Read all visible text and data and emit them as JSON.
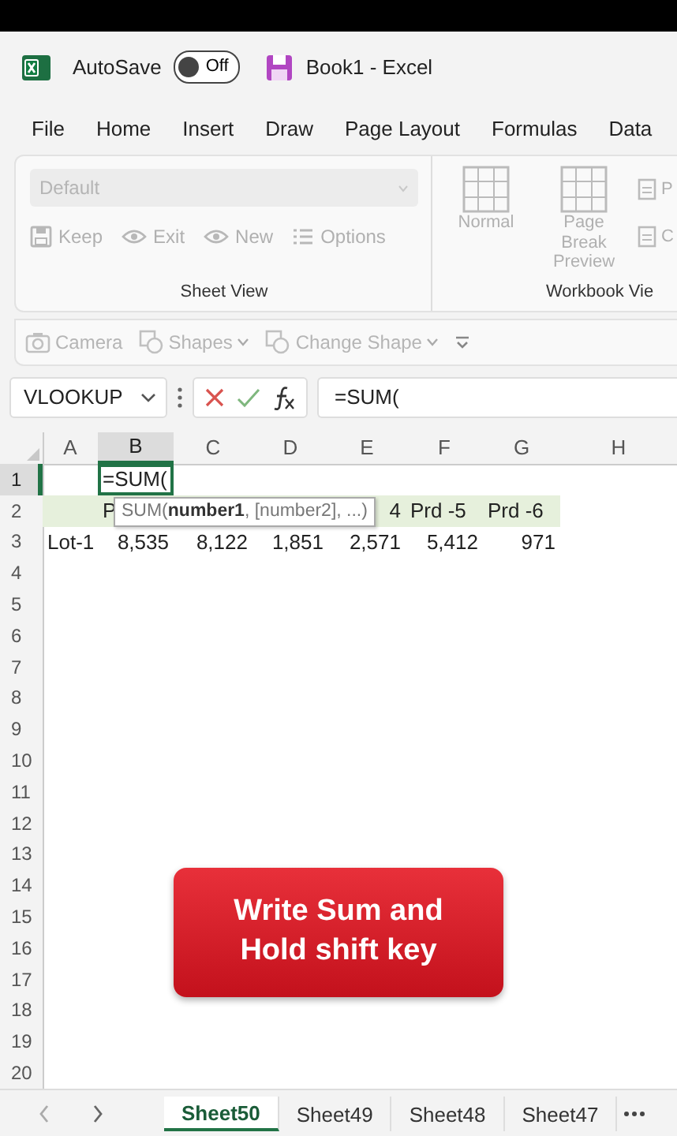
{
  "title_bar": {
    "autosave_label": "AutoSave",
    "autosave": {
      "on": false,
      "label": "Off"
    },
    "title": "Book1 - Excel"
  },
  "menu_tabs": [
    "File",
    "Home",
    "Insert",
    "Draw",
    "Page Layout",
    "Formulas",
    "Data"
  ],
  "ribbon": {
    "style_dropdown": {
      "value": "Default",
      "disabled": true
    },
    "sheet_view_buttons": [
      {
        "label": "Keep",
        "kind": "save"
      },
      {
        "label": "Exit",
        "kind": "eye"
      },
      {
        "label": "New",
        "kind": "eye"
      },
      {
        "label": "Options",
        "kind": "list"
      }
    ],
    "sheet_view_label": "Sheet View",
    "workbook_buttons": [
      {
        "label": "Normal",
        "kind": "large"
      },
      {
        "label": "Page Break Preview",
        "kind": "large"
      },
      {
        "label": "P",
        "kind": "small"
      },
      {
        "label": "C",
        "kind": "small"
      }
    ],
    "workbook_label": "Workbook Vie"
  },
  "quick_bar": [
    {
      "label": "Camera",
      "kind": "camera",
      "dropdown": false
    },
    {
      "label": "Shapes",
      "kind": "shapes",
      "dropdown": true
    },
    {
      "label": "Change Shape",
      "kind": "shapes",
      "dropdown": true
    }
  ],
  "formula_bar": {
    "name_box": "VLOOKUP",
    "formula": "=SUM("
  },
  "sheet": {
    "columns": [
      {
        "label": "A",
        "selected": false
      },
      {
        "label": "B",
        "selected": true
      },
      {
        "label": "C",
        "selected": false
      },
      {
        "label": "D",
        "selected": false
      },
      {
        "label": "E",
        "selected": false
      },
      {
        "label": "F",
        "selected": false
      },
      {
        "label": "G",
        "selected": false
      },
      {
        "label": "H",
        "selected": false
      }
    ],
    "rows": [
      {
        "number": "1",
        "selected": true,
        "highlighted": false,
        "kind": "edit",
        "cells": [
          "",
          "=SUM("
        ]
      },
      {
        "number": "2",
        "selected": false,
        "highlighted": true,
        "kind": "header",
        "cells": [
          "",
          "P",
          "",
          "",
          "4",
          "Prd -5",
          "Prd -6"
        ]
      },
      {
        "number": "3",
        "selected": false,
        "highlighted": false,
        "kind": "data",
        "cells": [
          "Lot-1",
          "8,535",
          "8,122",
          "1,851",
          "2,571",
          "5,412",
          "971"
        ]
      },
      {
        "number": "4",
        "selected": false,
        "highlighted": false,
        "kind": "empty",
        "cells": []
      },
      {
        "number": "5",
        "selected": false,
        "highlighted": false,
        "kind": "empty",
        "cells": []
      },
      {
        "number": "6",
        "selected": false,
        "highlighted": false,
        "kind": "empty",
        "cells": []
      },
      {
        "number": "7",
        "selected": false,
        "highlighted": false,
        "kind": "empty",
        "cells": []
      },
      {
        "number": "8",
        "selected": false,
        "highlighted": false,
        "kind": "empty",
        "cells": []
      },
      {
        "number": "9",
        "selected": false,
        "highlighted": false,
        "kind": "empty",
        "cells": []
      },
      {
        "number": "10",
        "selected": false,
        "highlighted": false,
        "kind": "empty",
        "cells": []
      },
      {
        "number": "11",
        "selected": false,
        "highlighted": false,
        "kind": "empty",
        "cells": []
      },
      {
        "number": "12",
        "selected": false,
        "highlighted": false,
        "kind": "empty",
        "cells": []
      },
      {
        "number": "13",
        "selected": false,
        "highlighted": false,
        "kind": "empty",
        "cells": []
      },
      {
        "number": "14",
        "selected": false,
        "highlighted": false,
        "kind": "empty",
        "cells": []
      },
      {
        "number": "15",
        "selected": false,
        "highlighted": false,
        "kind": "empty",
        "cells": []
      },
      {
        "number": "16",
        "selected": false,
        "highlighted": false,
        "kind": "empty",
        "cells": []
      },
      {
        "number": "17",
        "selected": false,
        "highlighted": false,
        "kind": "empty",
        "cells": []
      },
      {
        "number": "18",
        "selected": false,
        "highlighted": false,
        "kind": "empty",
        "cells": []
      },
      {
        "number": "19",
        "selected": false,
        "highlighted": false,
        "kind": "empty",
        "cells": []
      },
      {
        "number": "20",
        "selected": false,
        "highlighted": false,
        "kind": "empty",
        "cells": []
      }
    ],
    "tooltip": "SUM(**number1**, [number2], ...)"
  },
  "caption": [
    "Write Sum and",
    "Hold shift key"
  ],
  "sheet_tabs": [
    {
      "label": "Sheet50",
      "selected": true
    },
    {
      "label": "Sheet49",
      "selected": false
    },
    {
      "label": "Sheet48",
      "selected": false
    },
    {
      "label": "Sheet47",
      "selected": false
    }
  ]
}
